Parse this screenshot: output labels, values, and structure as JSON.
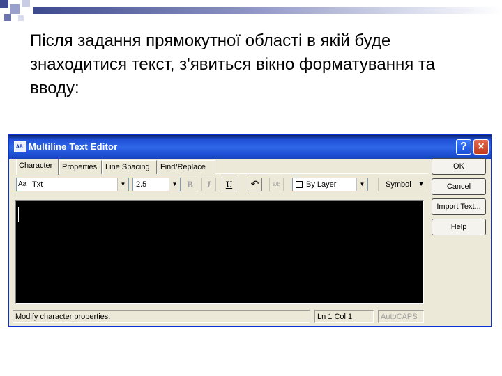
{
  "slide": {
    "text": "Після задання прямокутної області в якій буде знаходитися текст, з'явиться вікно форматування та вводу:"
  },
  "window": {
    "title": "Multiline Text Editor",
    "help_label": "?",
    "close_label": "×"
  },
  "tabs": [
    {
      "label": "Character",
      "active": true
    },
    {
      "label": "Properties",
      "active": false
    },
    {
      "label": "Line Spacing",
      "active": false
    },
    {
      "label": "Find/Replace",
      "active": false
    }
  ],
  "toolbar": {
    "font_icon": "Aa",
    "font_value": "Txt",
    "height_value": "2.5",
    "bold_label": "B",
    "italic_label": "I",
    "underline_label": "U",
    "undo_icon": "↶",
    "stack_icon": "a/b",
    "color_value": "By Layer",
    "symbol_label": "Symbol"
  },
  "buttons": {
    "ok": "OK",
    "cancel": "Cancel",
    "import": "Import Text...",
    "help": "Help"
  },
  "status": {
    "message": "Modify character properties.",
    "position": "Ln 1 Col 1",
    "autocaps": "AutoCAPS"
  },
  "colors": {
    "titlebar": "#2f67e8",
    "window_bg": "#ece9d8",
    "editor_bg": "#000000",
    "deco_dark": "#3d4a8f"
  }
}
